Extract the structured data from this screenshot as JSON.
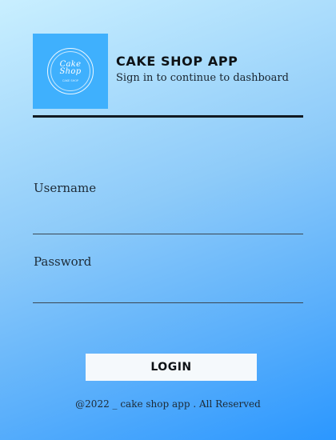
{
  "logo": {
    "line1": "Cake",
    "line2": "Shop",
    "small": "CAKE SHOP"
  },
  "header": {
    "title": "CAKE SHOP APP",
    "subtitle": "Sign in to continue to dashboard"
  },
  "form": {
    "username_label": "Username",
    "username_value": "",
    "password_label": "Password",
    "password_value": "",
    "login_label": "LOGIN"
  },
  "footer": {
    "text": "@2022 _ cake shop app . All Reserved"
  },
  "colors": {
    "logo_bg": "#3fb0fd",
    "rule": "#111a22",
    "button_bg": "#f5f9fc"
  }
}
